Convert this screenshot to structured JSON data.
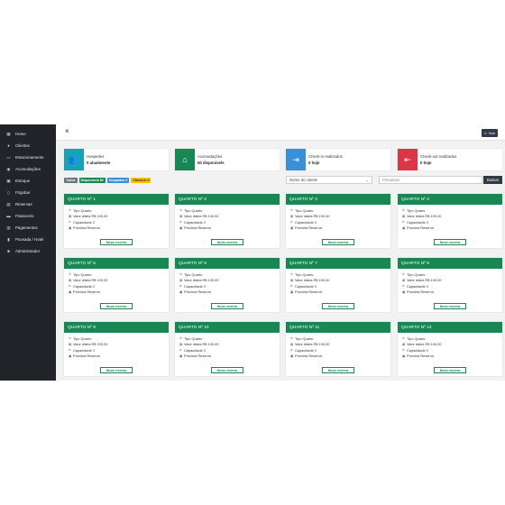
{
  "sidebar": {
    "items": [
      {
        "label": "Home",
        "icon": "grid-icon",
        "glyph": "▦"
      },
      {
        "label": "Clientes",
        "icon": "user-icon",
        "glyph": "●"
      },
      {
        "label": "Estacionamento",
        "icon": "car-icon",
        "glyph": "▭"
      },
      {
        "label": "Acomodações",
        "icon": "people-icon",
        "glyph": "◉"
      },
      {
        "label": "Estoque",
        "icon": "box-icon",
        "glyph": "▣"
      },
      {
        "label": "Frigobar",
        "icon": "fridge-icon",
        "glyph": "▯"
      },
      {
        "label": "Reservas",
        "icon": "calendar-icon",
        "glyph": "▤"
      },
      {
        "label": "Financeiro",
        "icon": "money-icon",
        "glyph": "▬"
      },
      {
        "label": "Pagamentos",
        "icon": "card-icon",
        "glyph": "▥"
      },
      {
        "label": "Pousada / Hotel",
        "icon": "building-icon",
        "glyph": "▮"
      },
      {
        "label": "Administrador",
        "icon": "lock-icon",
        "glyph": "■"
      }
    ]
  },
  "topbar": {
    "close_label": "×",
    "exit_label": "Sair"
  },
  "stats": [
    {
      "label": "Hospedes",
      "value": "0 atualmente",
      "color": "#17a2b8",
      "icon": "users-icon",
      "glyph": "👥"
    },
    {
      "label": "Acomodações",
      "value": "50 disponivels",
      "color": "#198754",
      "icon": "home-icon",
      "glyph": "⌂"
    },
    {
      "label": "Check-in realizados",
      "value": "0 hoje",
      "color": "#3a8fd9",
      "icon": "checkin-icon",
      "glyph": "⇥"
    },
    {
      "label": "Check-out realizados",
      "value": "0 hoje",
      "color": "#dc3545",
      "icon": "checkout-icon",
      "glyph": "⇤"
    }
  ],
  "filters": [
    {
      "label": "Todos",
      "bg": "#6c757d",
      "fg": "#ffffff"
    },
    {
      "label": "Disponíveis 50",
      "bg": "#198754",
      "fg": "#ffffff"
    },
    {
      "label": "Ocupados 0",
      "bg": "#3a8fd9",
      "fg": "#ffffff"
    },
    {
      "label": "Check-in 0",
      "bg": "#ffc107",
      "fg": "#222222"
    }
  ],
  "search": {
    "select_value": "Nome do cliente",
    "placeholder": "Pesquisar",
    "button_label": "Buscar"
  },
  "rooms": [
    {
      "title": "QUARTO  Nº 1"
    },
    {
      "title": "QUARTO  Nº 2"
    },
    {
      "title": "QUARTO  Nº 3"
    },
    {
      "title": "QUARTO  Nº 4"
    },
    {
      "title": "QUARTO  Nº 5"
    },
    {
      "title": "QUARTO  Nº 6"
    },
    {
      "title": "QUARTO  Nº 7"
    },
    {
      "title": "QUARTO  Nº 8"
    },
    {
      "title": "QUARTO  Nº 9"
    },
    {
      "title": "QUARTO  Nº 10"
    },
    {
      "title": "QUARTO  Nº 11"
    },
    {
      "title": "QUARTO  Nº 12"
    }
  ],
  "room_fields": {
    "tipo": "Tipo Quarto",
    "valor": "Valor diária R$ 100,00",
    "capacidade": "Capacidade 2",
    "proxima": "Próxima Reserva",
    "button": "Nova reserva"
  }
}
